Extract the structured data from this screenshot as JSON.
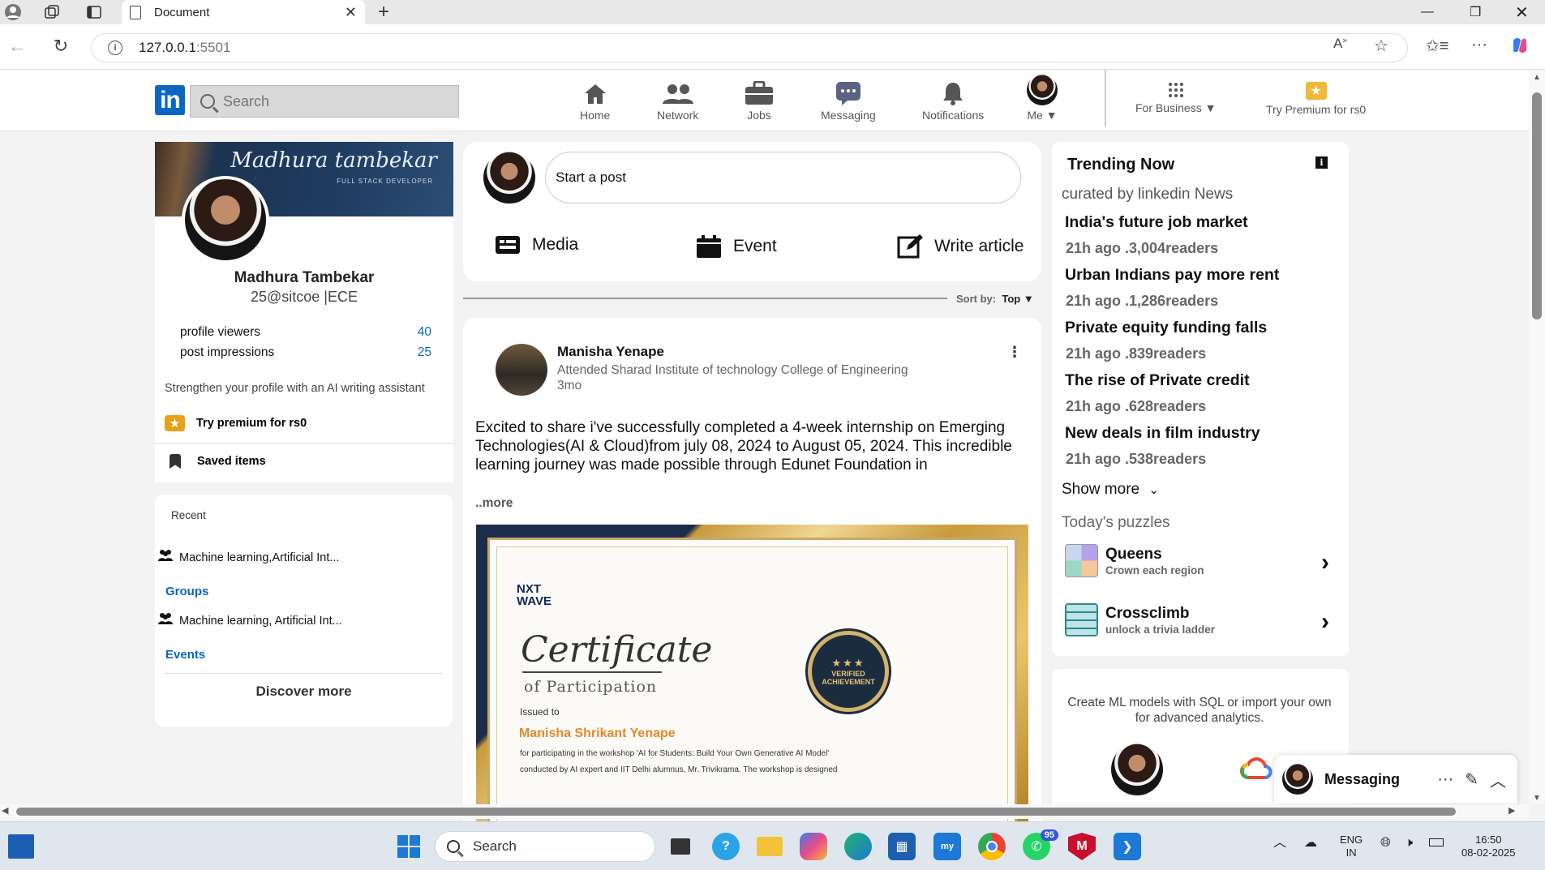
{
  "browser": {
    "tab_title": "Document",
    "url_host": "127.0.0.1",
    "url_port": ":5501"
  },
  "header": {
    "search_placeholder": "Search",
    "nav": [
      {
        "label": "Home"
      },
      {
        "label": "Network"
      },
      {
        "label": "Jobs"
      },
      {
        "label": "Messaging"
      },
      {
        "label": "Notifications"
      },
      {
        "label": "Me"
      },
      {
        "label": "For Business"
      },
      {
        "label": "Try Premium for rs0"
      }
    ]
  },
  "profile": {
    "banner_name": "Madhura tambekar",
    "banner_sub": "FULL STACK DEVELOPER",
    "name": "Madhura Tambekar",
    "headline": "25@sitcoe |ECE",
    "stats": [
      {
        "label": "profile viewers",
        "value": "40"
      },
      {
        "label": "post impressions",
        "value": "25"
      }
    ],
    "strengthen": "Strengthen your profile with an AI writing assistant",
    "premium": "Try premium for rs0",
    "saved": "Saved items"
  },
  "recent": {
    "title": "Recent",
    "items": [
      "Machine learning,Artificial Int...",
      "Machine learning, Artificial Int..."
    ],
    "groups": "Groups",
    "events": "Events",
    "discover": "Discover more"
  },
  "postbox": {
    "placeholder": "Start a post",
    "media": "Media",
    "event": "Event",
    "article": "Write article"
  },
  "sort": {
    "label": "Sort by:",
    "value": "Top"
  },
  "post": {
    "author": "Manisha Yenape",
    "subtitle": "Attended Sharad Institute of technology College of Engineering",
    "time": "3mo",
    "text": "Excited to share i've successfully completed a 4-week internship on Emerging Technologies(AI & Cloud)from july 08, 2024 to August 05, 2024. This incredible learning journey was made possible through Edunet Foundation in",
    "more": "..more",
    "certificate": {
      "logo_line1": "NXT",
      "logo_line2": "WAVE",
      "title": "Certificate",
      "of": "of Participation",
      "issued": "Issued to",
      "recipient": "Manisha Shrikant Yenape",
      "desc1": "for participating in the workshop 'AI for Students: Build Your Own Generative AI Model'",
      "desc2": "conducted by AI expert and IIT Delhi alumnus, Mr. Trivikrama. The workshop is designed",
      "seal_top": "★★★",
      "seal_line1": "VERIFIED",
      "seal_line2": "ACHIEVEMENT"
    }
  },
  "trending": {
    "title": "Trending Now",
    "info_icon": "i",
    "curated": "curated by linkedin News",
    "items": [
      {
        "headline": "India's future job market",
        "meta": "21h ago .3,004readers"
      },
      {
        "headline": "Urban Indians pay more rent",
        "meta": "21h ago .1,286readers"
      },
      {
        "headline": "Private equity funding falls",
        "meta": "21h ago .839readers"
      },
      {
        "headline": "The rise of Private credit",
        "meta": "21h ago .628readers"
      },
      {
        "headline": "New deals in film industry",
        "meta": "21h ago .538readers"
      }
    ],
    "show_more": "Show more",
    "puzzles_title": "Today's puzzles",
    "puzzles": [
      {
        "title": "Queens",
        "sub": "Crown each region"
      },
      {
        "title": "Crossclimb",
        "sub": "unlock a trivia ladder"
      }
    ]
  },
  "ad": {
    "text": "Create ML models with SQL or import your own for advanced analytics."
  },
  "messaging": {
    "label": "Messaging"
  },
  "taskbar": {
    "search": "Search",
    "whatsapp_badge": "95",
    "lang1": "ENG",
    "lang2": "IN",
    "time": "16:50",
    "date": "08-02-2025"
  },
  "colors": {
    "linkedin_blue": "#0a66c2",
    "premium_gold": "#e6a11b"
  }
}
